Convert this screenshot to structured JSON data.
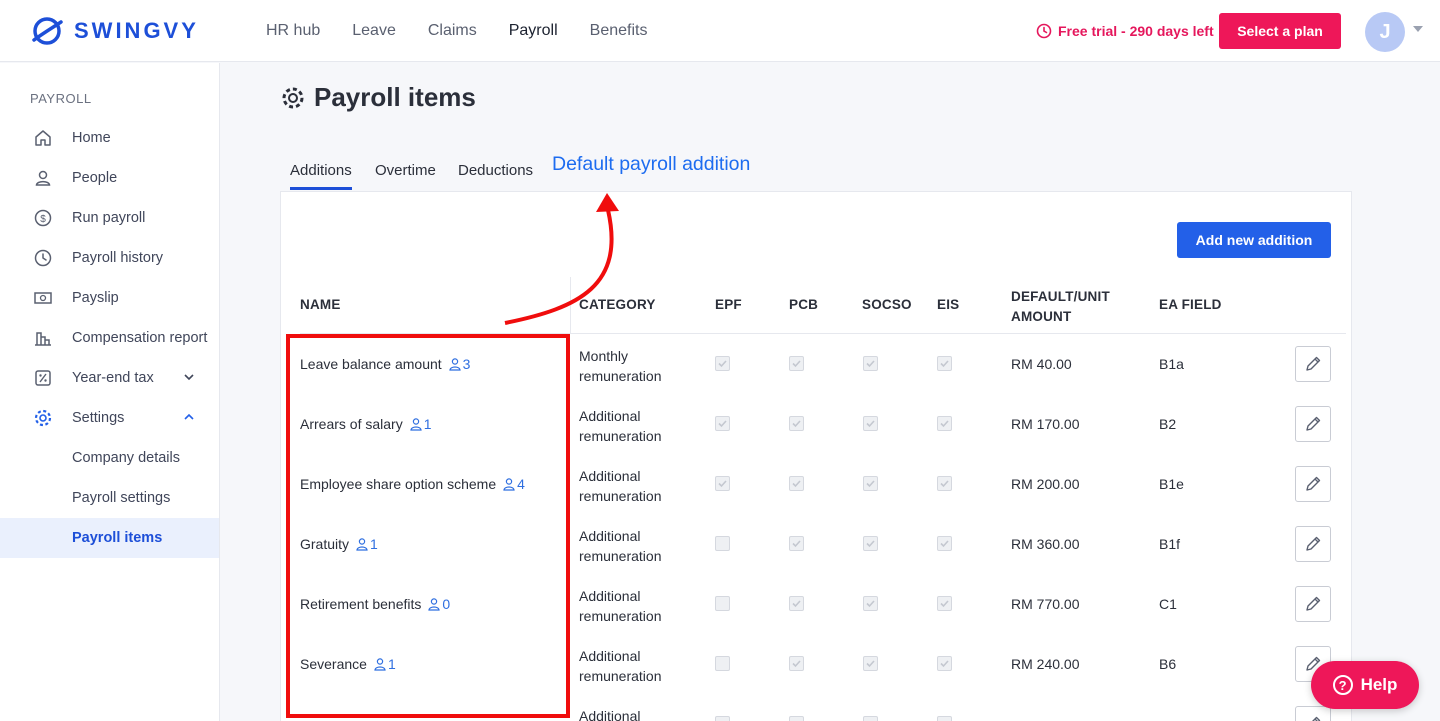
{
  "brand": {
    "name": "SWINGVY",
    "color": "#1d4fd8"
  },
  "topnav": [
    "HR hub",
    "Leave",
    "Claims",
    "Payroll",
    "Benefits"
  ],
  "trial": {
    "text": "Free trial - 290 days left",
    "icon": "clock-icon"
  },
  "plan_button": "Select a plan",
  "avatar_initial": "J",
  "sidebar": {
    "heading": "PAYROLL",
    "items": [
      {
        "label": "Home",
        "icon": "home-icon"
      },
      {
        "label": "People",
        "icon": "person-icon"
      },
      {
        "label": "Run payroll",
        "icon": "dollar-cycle-icon"
      },
      {
        "label": "Payroll history",
        "icon": "history-icon"
      },
      {
        "label": "Payslip",
        "icon": "banknote-icon"
      },
      {
        "label": "Compensation report",
        "icon": "bar-chart-icon"
      },
      {
        "label": "Year-end tax",
        "icon": "percent-icon"
      },
      {
        "label": "Settings",
        "icon": "gear-icon"
      },
      {
        "label": "Company details"
      },
      {
        "label": "Payroll settings"
      },
      {
        "label": "Payroll items"
      }
    ]
  },
  "page": {
    "title": "Payroll items",
    "icon": "gear-icon"
  },
  "tabs": [
    "Additions",
    "Overtime",
    "Deductions"
  ],
  "active_tab": "Additions",
  "annotation": "Default payroll addition",
  "add_button": "Add new addition",
  "table": {
    "headers": {
      "name": "NAME",
      "category": "CATEGORY",
      "epf": "EPF",
      "pcb": "PCB",
      "socso": "SOCSO",
      "eis": "EIS",
      "amount_1": "DEFAULT/UNIT",
      "amount_2": "AMOUNT",
      "ea": "EA FIELD"
    },
    "rows": [
      {
        "name": "Leave balance amount",
        "count": "3",
        "cat1": "Monthly",
        "cat2": "remuneration",
        "epf": true,
        "pcb": true,
        "socso": true,
        "eis": true,
        "amount": "RM 40.00",
        "ea": "B1a"
      },
      {
        "name": "Arrears of salary",
        "count": "1",
        "cat1": "Additional",
        "cat2": "remuneration",
        "epf": true,
        "pcb": true,
        "socso": true,
        "eis": true,
        "amount": "RM 170.00",
        "ea": "B2"
      },
      {
        "name": "Employee share option scheme",
        "count": "4",
        "cat1": "Additional",
        "cat2": "remuneration",
        "epf": true,
        "pcb": true,
        "socso": true,
        "eis": true,
        "amount": "RM 200.00",
        "ea": "B1e"
      },
      {
        "name": "Gratuity",
        "count": "1",
        "cat1": "Additional",
        "cat2": "remuneration",
        "epf": false,
        "pcb": true,
        "socso": true,
        "eis": true,
        "amount": "RM 360.00",
        "ea": "B1f"
      },
      {
        "name": "Retirement benefits",
        "count": "0",
        "cat1": "Additional",
        "cat2": "remuneration",
        "epf": false,
        "pcb": true,
        "socso": true,
        "eis": true,
        "amount": "RM 770.00",
        "ea": "C1"
      },
      {
        "name": "Severance",
        "count": "1",
        "cat1": "Additional",
        "cat2": "remuneration",
        "epf": false,
        "pcb": true,
        "socso": true,
        "eis": true,
        "amount": "RM 240.00",
        "ea": "B6"
      },
      {
        "name": "",
        "count": "",
        "cat1": "Additional",
        "cat2": "",
        "epf": false,
        "pcb": false,
        "socso": false,
        "eis": false,
        "amount": "",
        "ea": ""
      }
    ]
  },
  "help_button": "Help",
  "colors": {
    "accent": "#1d4fd8",
    "pink": "#ee1759",
    "annotation_red": "#f00d0d",
    "annotation_blue": "#1d6cf0"
  }
}
